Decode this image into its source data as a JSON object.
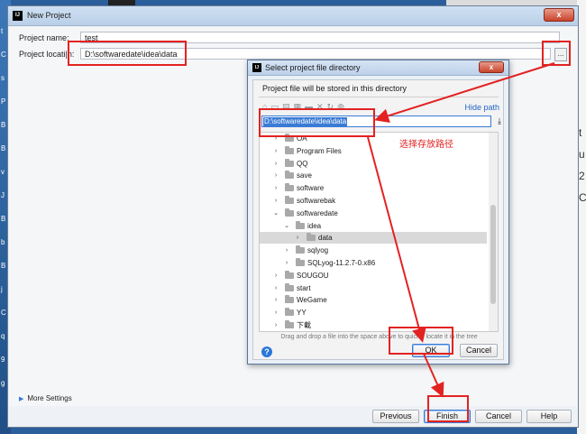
{
  "desktop": {
    "left_glyphs": [
      "t",
      "C",
      "s",
      "P",
      "B",
      "B",
      "v",
      "J",
      "B",
      "b",
      "B",
      "j",
      "C",
      "q",
      "9",
      "g"
    ],
    "right_glyphs": [
      "t",
      "u",
      "2",
      "C"
    ]
  },
  "window": {
    "title": "New Project",
    "close_glyph": "x",
    "project_name_label": "Project name:",
    "project_name_value": "test",
    "project_location_label": "Project locati",
    "project_location_value": "D:\\softwaredate\\idea\\data",
    "browse_label": "...",
    "more_settings_label": "More Settings",
    "buttons": {
      "previous": "Previous",
      "finish": "Finish",
      "cancel": "Cancel",
      "help": "Help"
    }
  },
  "dialog": {
    "title": "Select project file directory",
    "close_glyph": "x",
    "info_text": "Project file will be stored in this directory",
    "toolbar_icons": [
      "home-icon",
      "desktop-icon",
      "project-icon",
      "module-icon",
      "new-folder-icon",
      "delete-icon",
      "refresh-icon",
      "show-hidden-icon"
    ],
    "hide_path_label": "Hide path",
    "path_value": "D:\\softwaredate\\idea\\data",
    "tree": [
      {
        "name": "OA",
        "expanded": false,
        "selected": false
      },
      {
        "name": "Program Files",
        "expanded": false,
        "selected": false
      },
      {
        "name": "QQ",
        "expanded": false,
        "selected": false
      },
      {
        "name": "save",
        "expanded": false,
        "selected": false
      },
      {
        "name": "software",
        "expanded": false,
        "selected": false
      },
      {
        "name": "softwarebak",
        "expanded": false,
        "selected": false
      },
      {
        "name": "softwaredate",
        "expanded": true,
        "selected": false
      },
      {
        "name": "idea",
        "expanded": true,
        "selected": false
      },
      {
        "name": "data",
        "expanded": false,
        "selected": true
      },
      {
        "name": "sqlyog",
        "expanded": false,
        "selected": false
      },
      {
        "name": "SQLyog-11.2.7-0.x86",
        "expanded": false,
        "selected": false
      },
      {
        "name": "SOUGOU",
        "expanded": false,
        "selected": false
      },
      {
        "name": "start",
        "expanded": false,
        "selected": false
      },
      {
        "name": "WeGame",
        "expanded": false,
        "selected": false
      },
      {
        "name": "YY",
        "expanded": false,
        "selected": false
      },
      {
        "name": "下載",
        "expanded": false,
        "selected": false
      }
    ],
    "drag_hint": "Drag and drop a file into the space above to quickly locate it in the tree",
    "ok_label": "OK",
    "cancel_label": "Cancel",
    "help_glyph": "?"
  },
  "annotation": {
    "note": "选择存放路径",
    "color": "#e32222"
  }
}
